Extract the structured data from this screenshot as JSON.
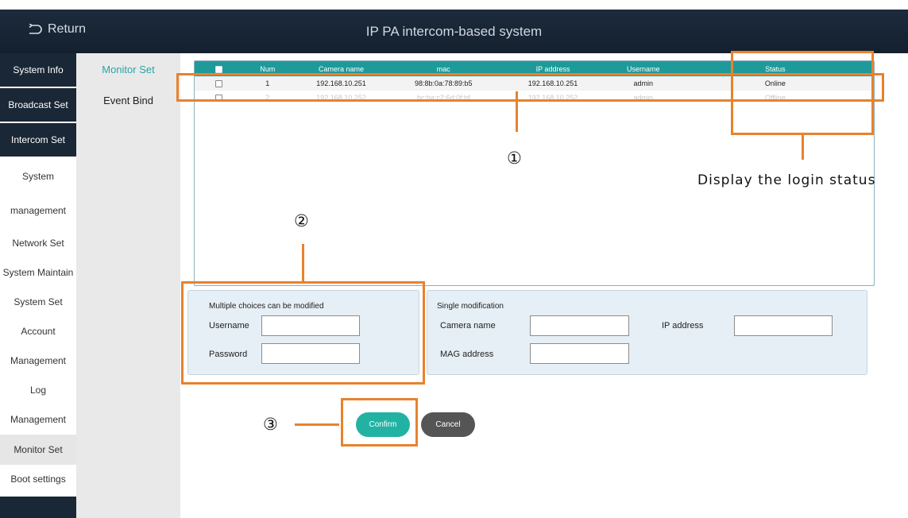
{
  "header": {
    "return_label": "Return",
    "title": "IP PA intercom-based system"
  },
  "nav": {
    "items": [
      "System Info",
      "Broadcast Set",
      "Intercom Set",
      "System",
      "management",
      "Network Set",
      "System Maintain",
      "System Set",
      "Account",
      "Management",
      "Log",
      "Management",
      "Monitor Set",
      "Boot settings"
    ]
  },
  "subnav": {
    "items": [
      "Monitor Set",
      "Event Bind"
    ]
  },
  "table": {
    "columns": [
      "Num",
      "Camera name",
      "mac",
      "IP address",
      "Username",
      "Status"
    ],
    "rows": [
      {
        "num": "1",
        "camera_name": "192.168.10.251",
        "mac": "98:8b:0a:78:89:b5",
        "ip": "192.168.10.251",
        "username": "admin",
        "status": "Online"
      },
      {
        "num": "2",
        "camera_name": "192.168.10.252",
        "mac": "bc:ba:c2:6d:0f:bf",
        "ip": "192.168.10.252",
        "username": "admin",
        "status": "Offline"
      }
    ]
  },
  "multi_form": {
    "title": "Multiple choices can be modified",
    "username_label": "Username",
    "password_label": "Password",
    "username_value": "",
    "password_value": ""
  },
  "single_form": {
    "title": "Single modification",
    "camera_name_label": "Camera name",
    "ip_label": "IP address",
    "mag_label": "MAG address",
    "camera_name_value": "",
    "ip_value": "",
    "mag_value": ""
  },
  "buttons": {
    "confirm": "Confirm",
    "cancel": "Cancel"
  },
  "annotations": {
    "one": "①",
    "two": "②",
    "three": "③",
    "status_note": "Display the login status"
  },
  "colors": {
    "accent": "#1f9a9a",
    "annotation": "#e8822d",
    "header": "#1a2736"
  }
}
